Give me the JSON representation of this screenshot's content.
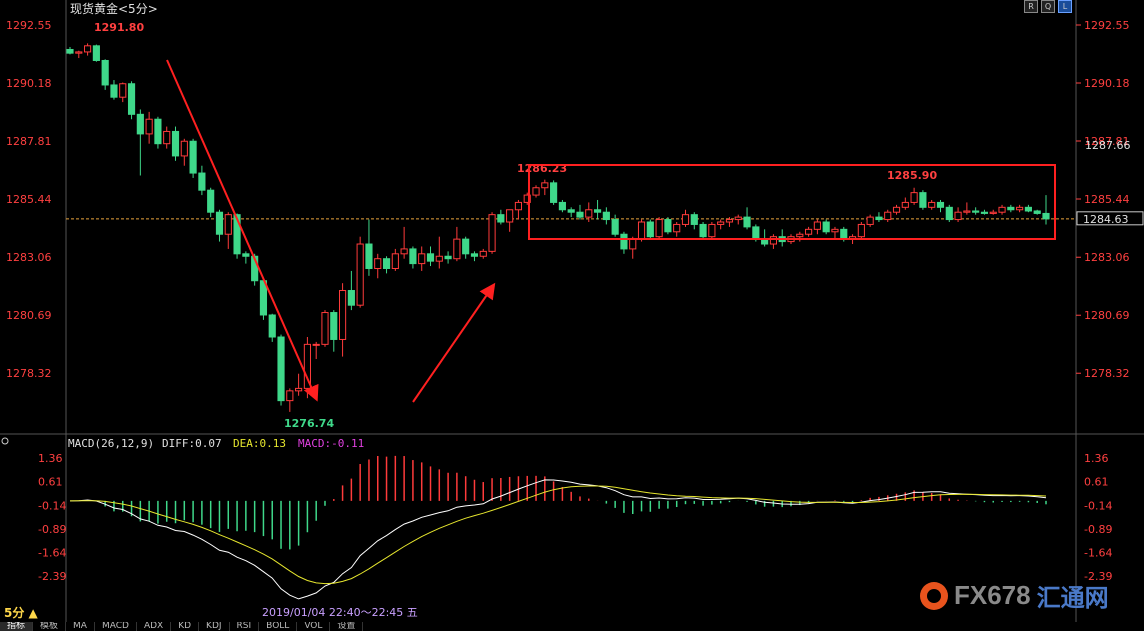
{
  "header": {
    "title": "现货黄金<5分>"
  },
  "toolbar": {
    "buttons": [
      "R",
      "Q",
      "L"
    ]
  },
  "chart_data": [
    {
      "type": "candlestick",
      "title": "现货黄金<5分>",
      "y_ticks": [
        "1292.55",
        "1290.18",
        "1287.81",
        "1285.44",
        "1283.06",
        "1280.69",
        "1278.32"
      ],
      "ylim": [
        1276.0,
        1293.0
      ],
      "current_price": "1284.63",
      "current_price_value": 1284.63,
      "right_extra_tick": "1287.66",
      "annotations": {
        "high1": "1291.80",
        "low": "1276.74",
        "high2": "1286.23",
        "high3": "1285.90"
      },
      "up_color": "#ff3b3b",
      "down_color": "#3fd88a",
      "candles": [
        [
          1291.55,
          1291.65,
          1291.35,
          1291.4
        ],
        [
          1291.4,
          1291.5,
          1291.2,
          1291.45
        ],
        [
          1291.45,
          1291.8,
          1291.3,
          1291.7
        ],
        [
          1291.7,
          1291.75,
          1291.05,
          1291.1
        ],
        [
          1291.1,
          1291.15,
          1289.9,
          1290.1
        ],
        [
          1290.1,
          1290.3,
          1289.5,
          1289.6
        ],
        [
          1289.6,
          1290.2,
          1289.4,
          1290.15
        ],
        [
          1290.15,
          1290.25,
          1288.7,
          1288.9
        ],
        [
          1288.9,
          1289.1,
          1286.4,
          1288.1
        ],
        [
          1288.1,
          1289.0,
          1287.7,
          1288.7
        ],
        [
          1288.7,
          1288.8,
          1287.5,
          1287.7
        ],
        [
          1287.7,
          1288.4,
          1287.5,
          1288.2
        ],
        [
          1288.2,
          1288.4,
          1287.0,
          1287.2
        ],
        [
          1287.2,
          1287.9,
          1286.8,
          1287.8
        ],
        [
          1287.8,
          1287.9,
          1286.3,
          1286.5
        ],
        [
          1286.5,
          1286.8,
          1285.6,
          1285.8
        ],
        [
          1285.8,
          1285.9,
          1284.7,
          1284.9
        ],
        [
          1284.9,
          1285.0,
          1283.7,
          1284.0
        ],
        [
          1284.0,
          1284.9,
          1283.4,
          1284.8
        ],
        [
          1284.8,
          1284.85,
          1283.0,
          1283.2
        ],
        [
          1283.2,
          1283.3,
          1282.8,
          1283.1
        ],
        [
          1283.1,
          1283.2,
          1281.9,
          1282.1
        ],
        [
          1282.1,
          1282.2,
          1280.5,
          1280.7
        ],
        [
          1280.7,
          1280.75,
          1279.6,
          1279.8
        ],
        [
          1279.8,
          1279.9,
          1277.0,
          1277.2
        ],
        [
          1277.2,
          1277.7,
          1276.74,
          1277.6
        ],
        [
          1277.6,
          1278.3,
          1277.4,
          1277.7
        ],
        [
          1277.7,
          1279.8,
          1277.3,
          1279.5
        ],
        [
          1279.5,
          1279.6,
          1278.9,
          1279.5
        ],
        [
          1279.5,
          1280.9,
          1279.4,
          1280.8
        ],
        [
          1280.8,
          1280.9,
          1279.2,
          1279.7
        ],
        [
          1279.7,
          1282.0,
          1279.0,
          1281.7
        ],
        [
          1281.7,
          1282.5,
          1280.9,
          1281.1
        ],
        [
          1281.1,
          1283.9,
          1281.0,
          1283.6
        ],
        [
          1283.6,
          1284.6,
          1282.3,
          1282.6
        ],
        [
          1282.6,
          1283.2,
          1282.2,
          1283.0
        ],
        [
          1283.0,
          1283.1,
          1282.4,
          1282.6
        ],
        [
          1282.6,
          1283.4,
          1282.5,
          1283.2
        ],
        [
          1283.2,
          1284.3,
          1283.0,
          1283.4
        ],
        [
          1283.4,
          1283.5,
          1282.6,
          1282.8
        ],
        [
          1282.8,
          1283.5,
          1282.5,
          1283.2
        ],
        [
          1283.2,
          1283.5,
          1282.7,
          1282.9
        ],
        [
          1282.9,
          1283.9,
          1282.6,
          1283.1
        ],
        [
          1283.1,
          1283.3,
          1282.8,
          1283.0
        ],
        [
          1283.0,
          1284.3,
          1282.9,
          1283.8
        ],
        [
          1283.8,
          1283.9,
          1283.0,
          1283.2
        ],
        [
          1283.2,
          1283.3,
          1282.9,
          1283.1
        ],
        [
          1283.1,
          1283.4,
          1283.0,
          1283.3
        ],
        [
          1283.3,
          1284.9,
          1283.2,
          1284.8
        ],
        [
          1284.8,
          1285.0,
          1284.4,
          1284.5
        ],
        [
          1284.5,
          1285.0,
          1284.1,
          1285.0
        ],
        [
          1285.0,
          1285.4,
          1284.6,
          1285.3
        ],
        [
          1285.3,
          1285.7,
          1285.2,
          1285.6
        ],
        [
          1285.6,
          1286.0,
          1285.5,
          1285.9
        ],
        [
          1285.9,
          1286.23,
          1285.6,
          1286.1
        ],
        [
          1286.1,
          1286.2,
          1285.2,
          1285.3
        ],
        [
          1285.3,
          1285.4,
          1284.9,
          1285.0
        ],
        [
          1285.0,
          1285.1,
          1284.7,
          1284.9
        ],
        [
          1284.9,
          1285.2,
          1284.6,
          1284.7
        ],
        [
          1284.7,
          1285.3,
          1284.5,
          1285.0
        ],
        [
          1285.0,
          1285.4,
          1284.6,
          1284.9
        ],
        [
          1284.9,
          1285.1,
          1284.4,
          1284.6
        ],
        [
          1284.6,
          1284.8,
          1283.9,
          1284.0
        ],
        [
          1284.0,
          1284.1,
          1283.2,
          1283.4
        ],
        [
          1283.4,
          1283.9,
          1283.0,
          1283.8
        ],
        [
          1283.8,
          1284.6,
          1283.7,
          1284.5
        ],
        [
          1284.5,
          1284.6,
          1283.8,
          1283.9
        ],
        [
          1283.9,
          1284.7,
          1283.8,
          1284.6
        ],
        [
          1284.6,
          1284.7,
          1284.0,
          1284.1
        ],
        [
          1284.1,
          1284.5,
          1283.9,
          1284.4
        ],
        [
          1284.4,
          1285.0,
          1284.3,
          1284.8
        ],
        [
          1284.8,
          1284.9,
          1284.2,
          1284.4
        ],
        [
          1284.4,
          1284.5,
          1283.8,
          1283.9
        ],
        [
          1283.9,
          1284.5,
          1283.8,
          1284.4
        ],
        [
          1284.4,
          1284.6,
          1284.2,
          1284.5
        ],
        [
          1284.5,
          1284.7,
          1284.3,
          1284.6
        ],
        [
          1284.6,
          1284.8,
          1284.4,
          1284.7
        ],
        [
          1284.7,
          1285.1,
          1284.2,
          1284.3
        ],
        [
          1284.3,
          1284.4,
          1283.7,
          1283.8
        ],
        [
          1283.8,
          1284.2,
          1283.5,
          1283.6
        ],
        [
          1283.6,
          1284.0,
          1283.4,
          1283.9
        ],
        [
          1283.9,
          1284.2,
          1283.5,
          1283.7
        ],
        [
          1283.7,
          1284.0,
          1283.6,
          1283.9
        ],
        [
          1283.9,
          1284.1,
          1283.7,
          1284.0
        ],
        [
          1284.0,
          1284.3,
          1283.9,
          1284.2
        ],
        [
          1284.2,
          1284.6,
          1284.0,
          1284.5
        ],
        [
          1284.5,
          1284.6,
          1284.0,
          1284.1
        ],
        [
          1284.1,
          1284.3,
          1283.8,
          1284.2
        ],
        [
          1284.2,
          1284.3,
          1283.7,
          1283.8
        ],
        [
          1283.8,
          1284.0,
          1283.6,
          1283.9
        ],
        [
          1283.9,
          1284.5,
          1283.8,
          1284.4
        ],
        [
          1284.4,
          1284.8,
          1284.3,
          1284.7
        ],
        [
          1284.7,
          1284.9,
          1284.5,
          1284.6
        ],
        [
          1284.6,
          1285.0,
          1284.5,
          1284.9
        ],
        [
          1284.9,
          1285.2,
          1284.8,
          1285.1
        ],
        [
          1285.1,
          1285.5,
          1285.0,
          1285.3
        ],
        [
          1285.3,
          1285.9,
          1285.2,
          1285.7
        ],
        [
          1285.7,
          1285.8,
          1285.0,
          1285.1
        ],
        [
          1285.1,
          1285.4,
          1285.0,
          1285.3
        ],
        [
          1285.3,
          1285.4,
          1284.9,
          1285.1
        ],
        [
          1285.1,
          1285.2,
          1284.5,
          1284.6
        ],
        [
          1284.6,
          1285.1,
          1284.5,
          1284.9
        ],
        [
          1284.9,
          1285.3,
          1284.8,
          1284.95
        ],
        [
          1284.95,
          1285.1,
          1284.8,
          1284.9
        ],
        [
          1284.9,
          1285.0,
          1284.8,
          1284.85
        ],
        [
          1284.85,
          1285.0,
          1284.8,
          1284.9
        ],
        [
          1284.9,
          1285.2,
          1284.8,
          1285.1
        ],
        [
          1285.1,
          1285.2,
          1284.9,
          1285.0
        ],
        [
          1285.0,
          1285.2,
          1284.9,
          1285.1
        ],
        [
          1285.1,
          1285.2,
          1284.9,
          1284.95
        ],
        [
          1284.95,
          1285.0,
          1284.8,
          1284.85
        ],
        [
          1284.85,
          1285.6,
          1284.4,
          1284.63
        ]
      ]
    },
    {
      "type": "bar",
      "title": "MACD(26,12,9)",
      "labels": {
        "name": "MACD(26,12,9)",
        "diff": "DIFF:0.07",
        "dea": "DEA:0.13",
        "macd": "MACD:-0.11"
      },
      "y_ticks": [
        "1.36",
        "0.61",
        "-0.14",
        "-0.89",
        "-1.64",
        "-2.39"
      ],
      "ylim": [
        -2.7,
        1.55
      ],
      "colors": {
        "diff": "#ffffff",
        "dea": "#e6e62e",
        "pos": "#ff3b3b",
        "neg": "#3fd88a"
      }
    }
  ],
  "footer": {
    "period": "5分 ▲",
    "timestamp": "2019/01/04  22:40～22:45  五",
    "tabs": [
      "指标",
      "模板",
      "MA",
      "MACD",
      "ADX",
      "KD",
      "KDJ",
      "RSI",
      "BOLL",
      "VOL",
      "设置"
    ]
  },
  "watermark": {
    "text": "FX678",
    "cn": "汇通网"
  }
}
